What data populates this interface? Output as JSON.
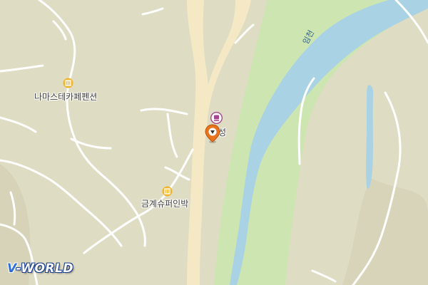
{
  "map": {
    "poi_pension_1": {
      "name": "나마스테카페펜션",
      "icon": "pension-icon"
    },
    "poi_pension_2": {
      "name": "금계슈퍼인박",
      "icon": "pension-icon"
    },
    "poi_shop": {
      "name": "성",
      "icon": "shop-icon"
    },
    "location_marker": {
      "icon": "location-pin-icon"
    },
    "river_name": "임천",
    "logo_prefix": "V",
    "logo_suffix": "-WORLD",
    "colors": {
      "land": "#dfdcc4",
      "riverbank": "#cde6b1",
      "water": "#a9d2e4",
      "road": "#ffffff",
      "highway": "#f4e9c4",
      "poi_orange": "#f0b52a",
      "marker": "#e8741e",
      "shop_purple": "#a5458f"
    }
  }
}
